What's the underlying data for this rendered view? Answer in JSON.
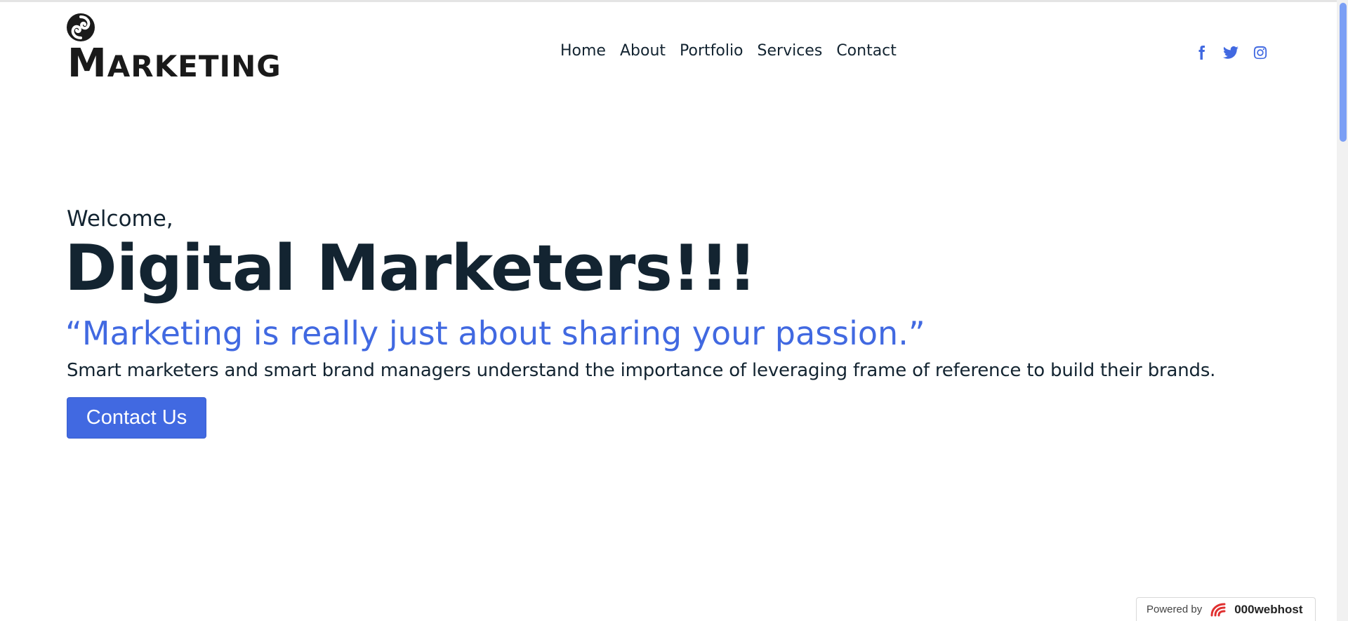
{
  "header": {
    "logo_text_first": "M",
    "logo_text_rest": "ARKETING",
    "nav": [
      {
        "label": "Home"
      },
      {
        "label": "About"
      },
      {
        "label": "Portfolio"
      },
      {
        "label": "Services"
      },
      {
        "label": "Contact"
      }
    ],
    "social_icons": [
      "facebook-icon",
      "twitter-icon",
      "instagram-icon"
    ]
  },
  "hero": {
    "welcome": "Welcome,",
    "headline": "Digital Marketers!!!",
    "quote": "“Marketing is really just about sharing your passion.”",
    "description": "Smart marketers and smart brand managers understand the importance of leveraging frame of reference to build their brands.",
    "cta_label": "Contact Us"
  },
  "badge": {
    "powered_by": "Powered by",
    "host_name": "000webhost"
  },
  "colors": {
    "accent": "#4169e1",
    "text": "#132431",
    "background": "#ffffff"
  }
}
